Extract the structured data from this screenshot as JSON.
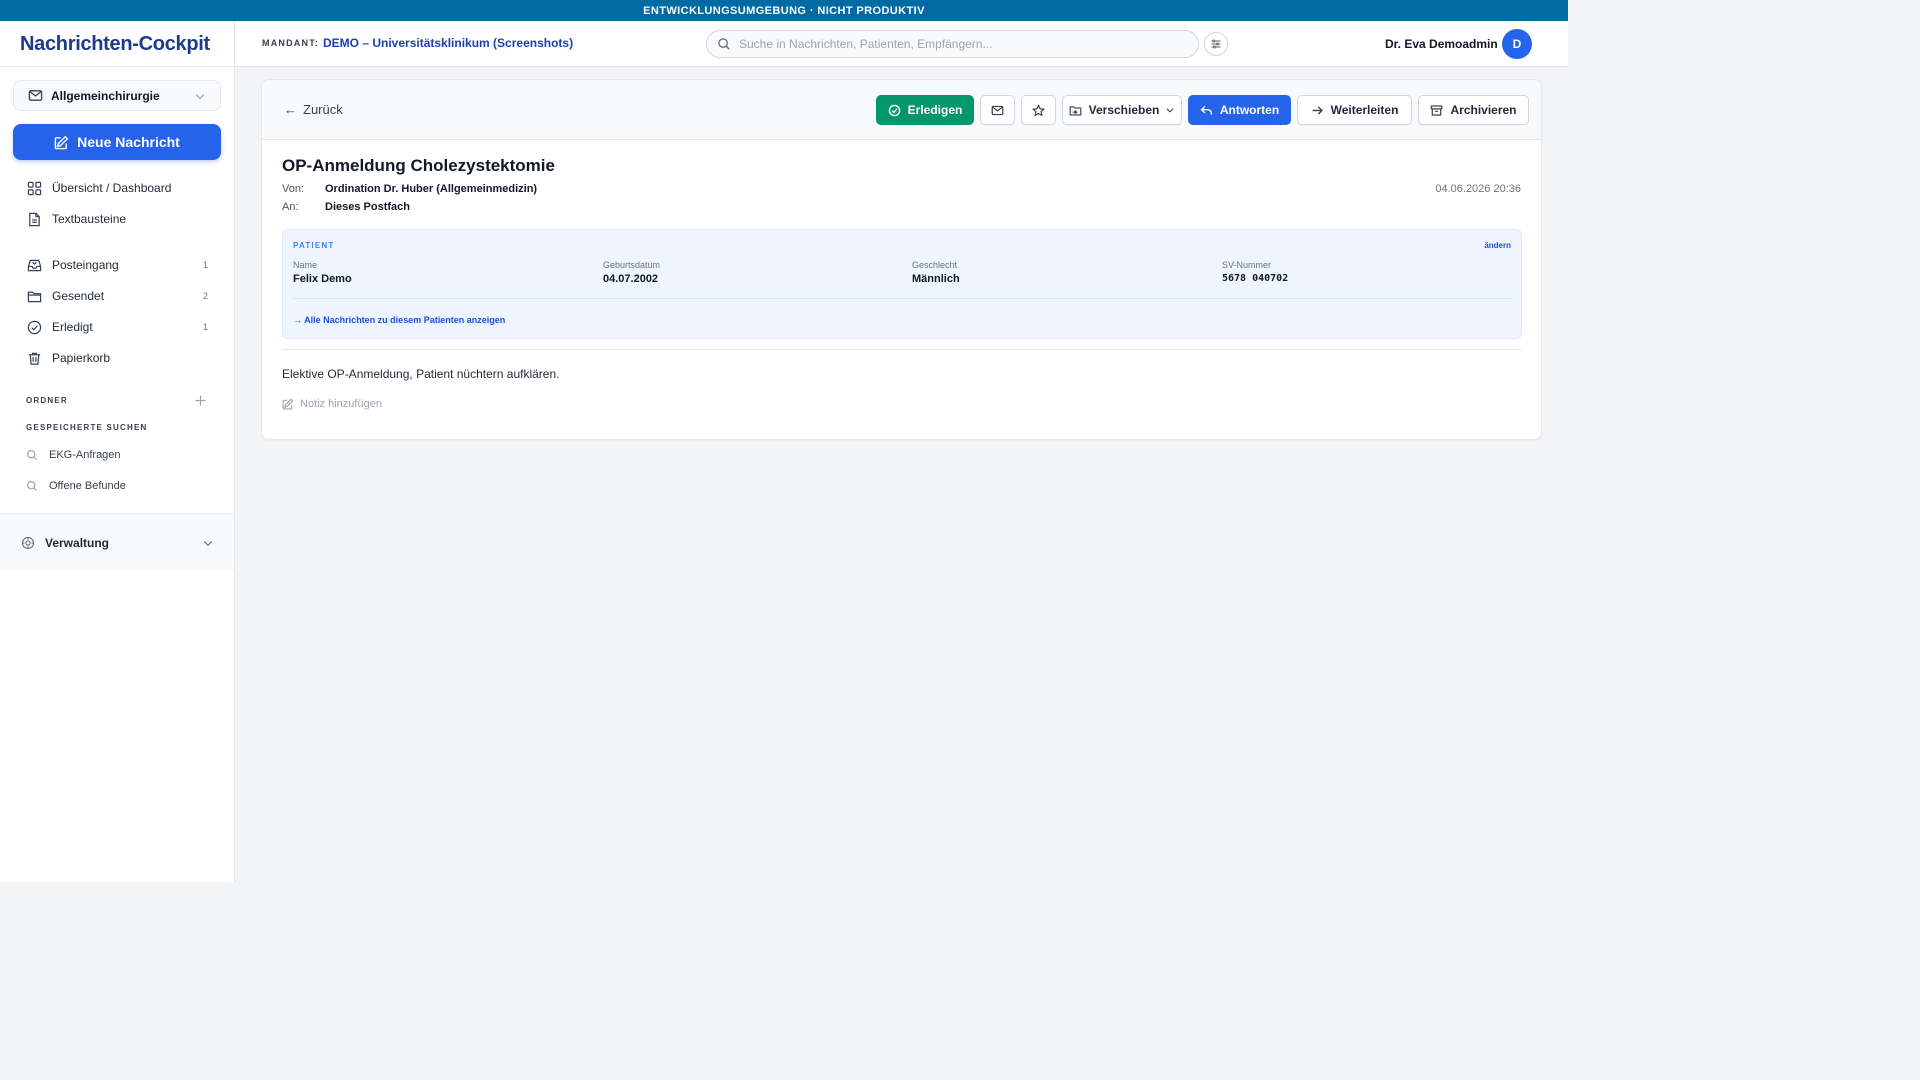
{
  "banner": {
    "text": "ENTWICKLUNGSUMGEBUNG · NICHT PRODUKTIV"
  },
  "header": {
    "brand": "Nachrichten-Cockpit",
    "tenant_label": "MANDANT:",
    "tenant_value": "DEMO – Universitätsklinikum (Screenshots)",
    "search_placeholder": "Suche in Nachrichten, Patienten, Empfängern...",
    "user_name": "Dr. Eva Demoadmin",
    "avatar_initial": "D"
  },
  "sidebar": {
    "department": "Allgemeinchirurgie",
    "new_message": "Neue Nachricht",
    "top_items": [
      {
        "label": "Übersicht / Dashboard",
        "icon": "grid-icon"
      },
      {
        "label": "Textbausteine",
        "icon": "document-icon"
      }
    ],
    "mail_items": [
      {
        "label": "Posteingang",
        "count": "1",
        "icon": "inbox-icon"
      },
      {
        "label": "Gesendet",
        "count": "2",
        "icon": "folder-icon"
      },
      {
        "label": "Erledigt",
        "count": "1",
        "icon": "check-circle-icon"
      },
      {
        "label": "Papierkorb",
        "count": "",
        "icon": "trash-icon"
      }
    ],
    "folders_label": "ORDNER",
    "saved_searches_label": "GESPEICHERTE SUCHEN",
    "saved_searches": [
      {
        "label": "EKG-Anfragen"
      },
      {
        "label": "Offene Befunde"
      }
    ],
    "admin_label": "Verwaltung"
  },
  "toolbar": {
    "back": "Zurück",
    "done": "Erledigen",
    "move": "Verschieben",
    "reply": "Antworten",
    "forward": "Weiterleiten",
    "archive": "Archivieren"
  },
  "message": {
    "subject": "OP-Anmeldung Cholezystektomie",
    "from_label": "Von:",
    "from_value": "Ordination Dr. Huber (Allgemeinmedizin)",
    "to_label": "An:",
    "to_value": "Dieses Postfach",
    "date": "04.06.2026 20:36",
    "body": "Elektive OP-Anmeldung, Patient nüchtern aufklären.",
    "add_note": "Notiz hinzufügen"
  },
  "patient": {
    "title": "PATIENT",
    "change": "ändern",
    "fields": [
      {
        "label": "Name",
        "value": "Felix Demo"
      },
      {
        "label": "Geburtsdatum",
        "value": "04.07.2002"
      },
      {
        "label": "Geschlecht",
        "value": "Männlich"
      },
      {
        "label": "SV-Nummer",
        "value": "5678 040702"
      }
    ],
    "all_messages_link": "→ Alle Nachrichten zu diesem Patienten anzeigen"
  },
  "colors": {
    "banner": "#006ba3",
    "primary": "#2563eb",
    "success": "#059669",
    "brand": "#1e3a8a"
  }
}
